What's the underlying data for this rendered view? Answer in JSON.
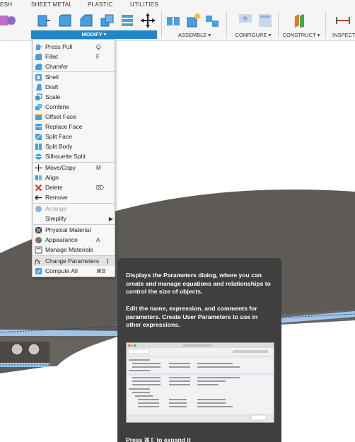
{
  "toolbar": {
    "tabs": [
      "ESH",
      "SHEET METAL",
      "PLASTIC",
      "UTILITIES"
    ],
    "groups": {
      "modify": "MODIFY ▾",
      "assemble": "ASSEMBLE ▾",
      "configure": "CONFIGURE ▾",
      "construct": "CONSTRUCT ▾",
      "inspect": "INSPECT"
    }
  },
  "menu": {
    "items": [
      {
        "label": "Press Pull",
        "shortcut": "Q",
        "icon": "press-pull-icon"
      },
      {
        "label": "Fillet",
        "shortcut": "F",
        "icon": "fillet-icon"
      },
      {
        "label": "Chamfer",
        "shortcut": "",
        "icon": "chamfer-icon"
      },
      {
        "label": "Shell",
        "shortcut": "",
        "icon": "shell-icon"
      },
      {
        "label": "Draft",
        "shortcut": "",
        "icon": "draft-icon"
      },
      {
        "label": "Scale",
        "shortcut": "",
        "icon": "scale-icon"
      },
      {
        "label": "Combine",
        "shortcut": "",
        "icon": "combine-icon"
      },
      {
        "label": "Offset Face",
        "shortcut": "",
        "icon": "offset-face-icon"
      },
      {
        "label": "Replace Face",
        "shortcut": "",
        "icon": "replace-face-icon"
      },
      {
        "label": "Split Face",
        "shortcut": "",
        "icon": "split-face-icon"
      },
      {
        "label": "Split Body",
        "shortcut": "",
        "icon": "split-body-icon"
      },
      {
        "label": "Silhouette Split",
        "shortcut": "",
        "icon": "silhouette-split-icon"
      },
      {
        "label": "Move/Copy",
        "shortcut": "M",
        "icon": "move-icon"
      },
      {
        "label": "Align",
        "shortcut": "",
        "icon": "align-icon"
      },
      {
        "label": "Delete",
        "shortcut": "⌦",
        "icon": "delete-icon"
      },
      {
        "label": "Remove",
        "shortcut": "",
        "icon": "remove-icon"
      },
      {
        "label": "Arrange",
        "shortcut": "",
        "icon": "arrange-icon"
      },
      {
        "label": "Simplify",
        "shortcut": "▶",
        "icon": ""
      },
      {
        "label": "Physical Material",
        "shortcut": "",
        "icon": "physical-material-icon"
      },
      {
        "label": "Appearance",
        "shortcut": "A",
        "icon": "appearance-icon"
      },
      {
        "label": "Manage Materials",
        "shortcut": "",
        "icon": "manage-materials-icon"
      },
      {
        "label": "Change Parameters",
        "shortcut": "⋮",
        "icon": "parameters-icon"
      },
      {
        "label": "Compute All",
        "shortcut": "⌘B",
        "icon": "compute-all-icon"
      }
    ]
  },
  "tooltip": {
    "para1": "Displays the Parameters dialog, where you can create and manage equations and relationships to control the size of objects.",
    "para2": "Edit the name, expression, and comments for parameters. Create User Parameters to use in other expressions.",
    "cut_off": "Press ⌘⇧ to expand it"
  },
  "colors": {
    "accent": "#1e87c9",
    "model": "#5e5b57",
    "tooltip_bg": "#3f3f3f"
  }
}
